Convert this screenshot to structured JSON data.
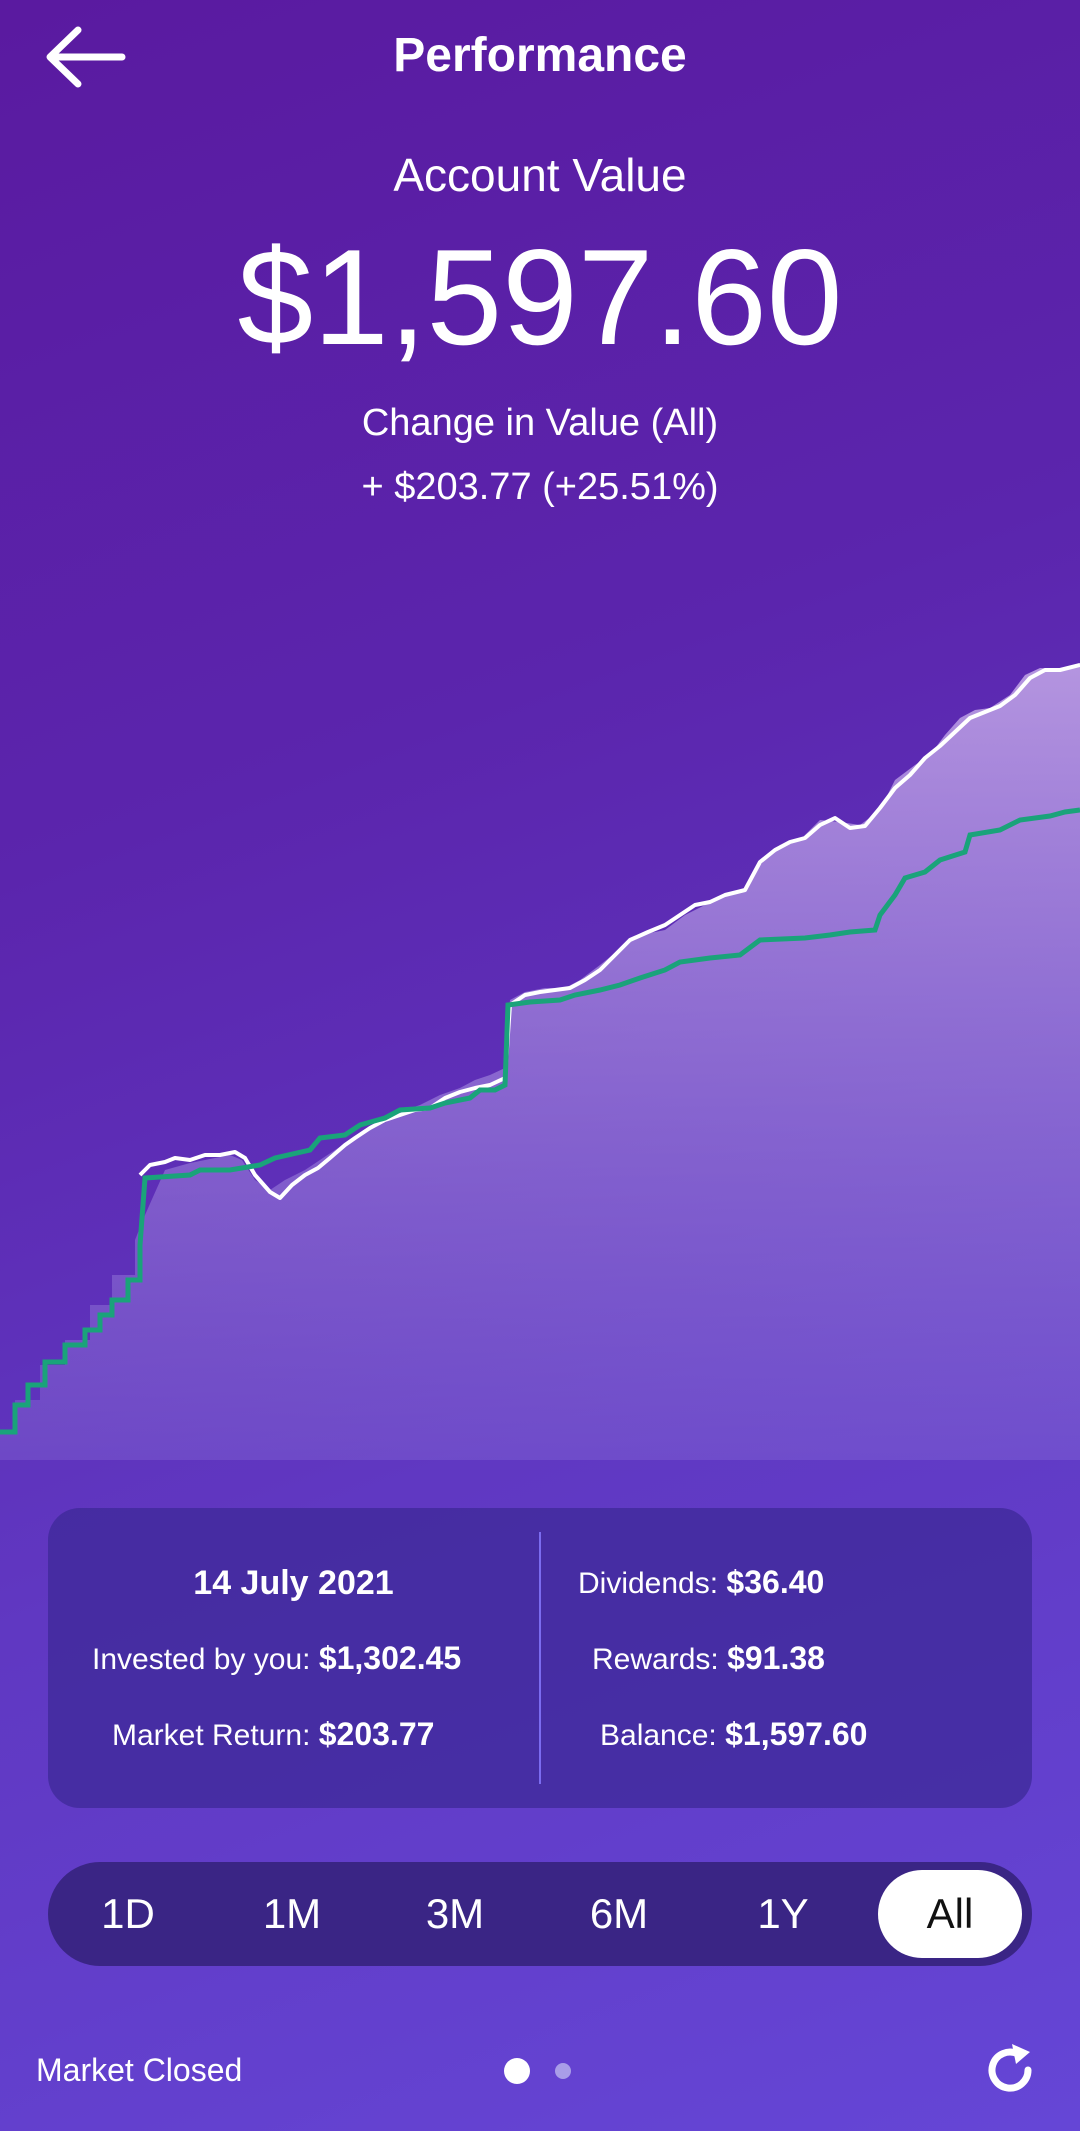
{
  "header": {
    "title": "Performance"
  },
  "account": {
    "label": "Account Value",
    "value": "$1,597.60",
    "change_label": "Change in Value (All)",
    "change_value": "+ $203.77 (+25.51%)"
  },
  "chart_data": {
    "type": "area",
    "series": [
      {
        "color": "#ffffff"
      },
      {
        "color": "#1aa37a"
      }
    ]
  },
  "summary": {
    "date": "14 July 2021",
    "invested_label": "Invested by you:",
    "invested_value": "$1,302.45",
    "market_return_label": "Market Return:",
    "market_return_value": "$203.77",
    "dividends_label": "Dividends:",
    "dividends_value": "$36.40",
    "rewards_label": "Rewards:",
    "rewards_value": "$91.38",
    "balance_label": "Balance:",
    "balance_value": "$1,597.60"
  },
  "ranges": [
    "1D",
    "1M",
    "3M",
    "6M",
    "1Y",
    "All"
  ],
  "selected_range": "All",
  "footer": {
    "market_status": "Market Closed"
  },
  "colors": {
    "accent_green": "#1aa37a",
    "card_bg": "#3c2896",
    "selector_bg": "#3a2585"
  },
  "icons": {
    "back": "arrow-left-icon",
    "refresh": "refresh-icon"
  }
}
